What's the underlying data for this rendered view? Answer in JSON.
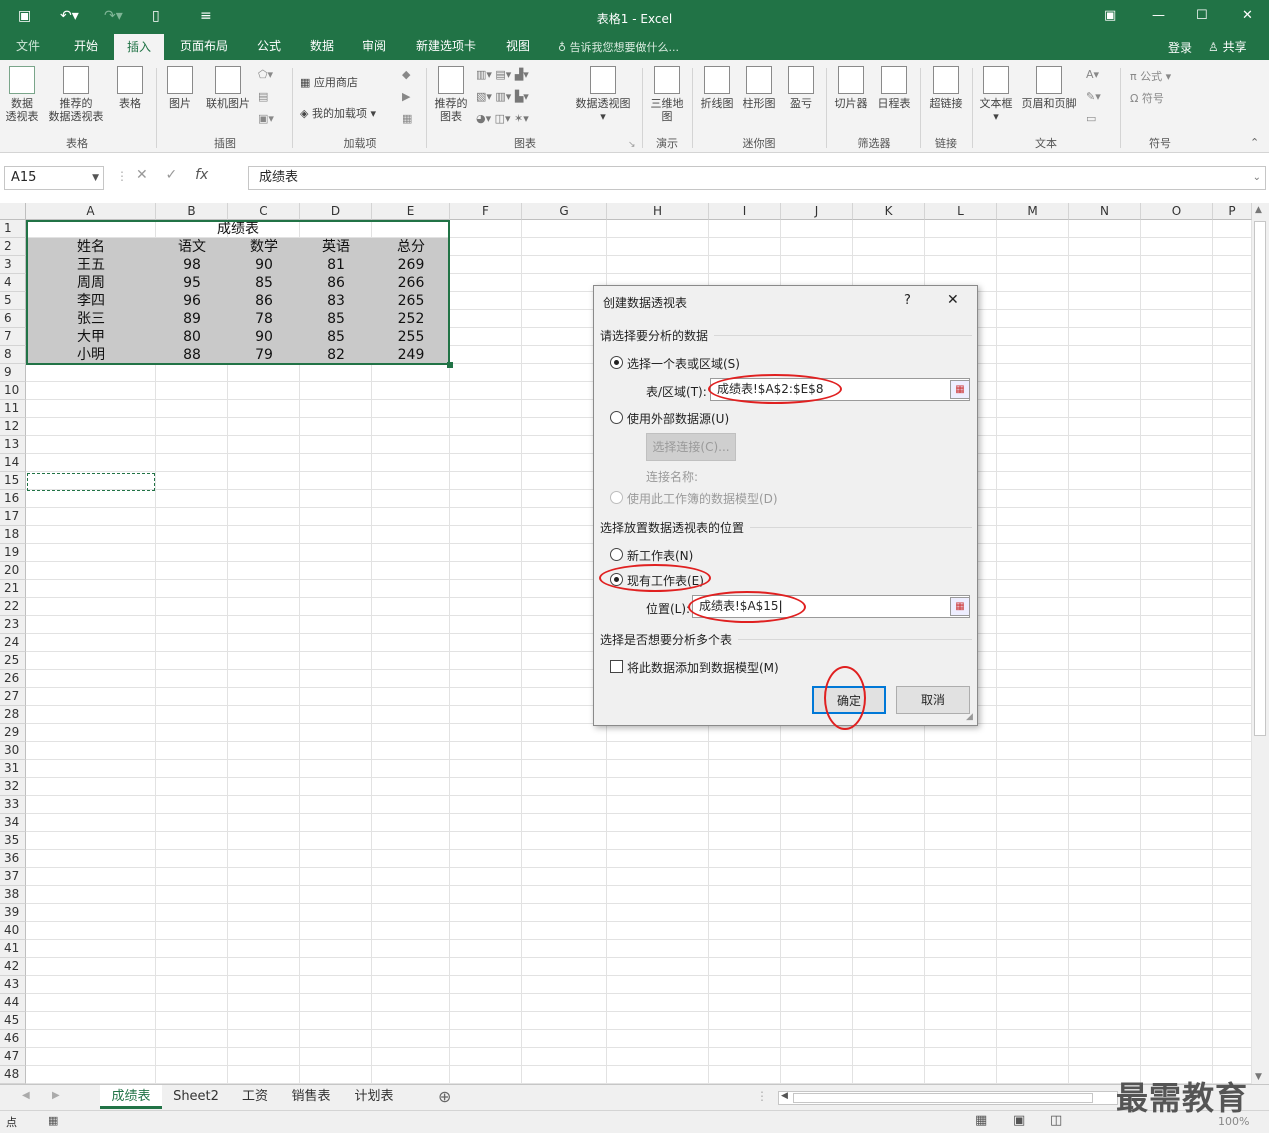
{
  "window": {
    "title": "表格1 - Excel"
  },
  "tabs": [
    "文件",
    "开始",
    "插入",
    "页面布局",
    "公式",
    "数据",
    "审阅",
    "新建选项卡",
    "视图"
  ],
  "tell_me": "告诉我您想要做什么...",
  "account": {
    "login": "登录",
    "share": "共享"
  },
  "ribbon": {
    "pivot": "数据\n透视表",
    "rec_pivot": "推荐的\n数据透视表",
    "table": "表格",
    "picture": "图片",
    "online_picture": "联机图片",
    "store": "应用商店",
    "my_addins": "我的加载项",
    "rec_charts": "推荐的\n图表",
    "pivot_chart": "数据透视图",
    "map3d": "三维地\n图",
    "line": "折线图",
    "column": "柱形图",
    "winloss": "盈亏",
    "slicer": "切片器",
    "timeline": "日程表",
    "hyperlink": "超链接",
    "textbox": "文本框",
    "header_footer": "页眉和页脚",
    "equation": "公式",
    "symbol": "符号",
    "groups": [
      "表格",
      "插图",
      "加载项",
      "图表",
      "演示",
      "迷你图",
      "筛选器",
      "链接",
      "文本",
      "符号"
    ]
  },
  "formula_bar": {
    "name_box": "A15",
    "content": "成绩表"
  },
  "columns": [
    "A",
    "B",
    "C",
    "D",
    "E",
    "F",
    "G",
    "H",
    "I",
    "J",
    "K",
    "L",
    "M",
    "N",
    "O",
    "P"
  ],
  "rows": [
    "1",
    "2",
    "3",
    "4",
    "5",
    "6",
    "7",
    "8",
    "9",
    "10",
    "11",
    "12",
    "13",
    "14",
    "15",
    "16",
    "17",
    "18",
    "19",
    "20",
    "21",
    "22",
    "23",
    "24",
    "25",
    "26",
    "27",
    "28",
    "29",
    "30",
    "31",
    "32",
    "33",
    "34",
    "35",
    "36",
    "37",
    "38",
    "39",
    "40",
    "41",
    "42",
    "43",
    "44",
    "45",
    "46",
    "47",
    "48"
  ],
  "sheet": {
    "title": "成绩表",
    "headers": [
      "姓名",
      "语文",
      "数学",
      "英语",
      "总分"
    ],
    "data": [
      [
        "王五",
        "98",
        "90",
        "81",
        "269"
      ],
      [
        "周周",
        "95",
        "85",
        "86",
        "266"
      ],
      [
        "李四",
        "96",
        "86",
        "83",
        "265"
      ],
      [
        "张三",
        "89",
        "78",
        "85",
        "252"
      ],
      [
        "大甲",
        "80",
        "90",
        "85",
        "255"
      ],
      [
        "小明",
        "88",
        "79",
        "82",
        "249"
      ]
    ]
  },
  "sheet_tabs": [
    "成绩表",
    "Sheet2",
    "工资",
    "销售表",
    "计划表"
  ],
  "status": {
    "zoom": "100%"
  },
  "watermark": "最需教育",
  "dialog": {
    "title": "创建数据透视表",
    "help": "?",
    "close": "✕",
    "section1": "请选择要分析的数据",
    "opt_range": "选择一个表或区域(S)",
    "range_label": "表/区域(T):",
    "range_value": "成绩表!$A$2:$E$8",
    "opt_external": "使用外部数据源(U)",
    "choose_conn": "选择连接(C)...",
    "conn_name": "连接名称:",
    "opt_model": "使用此工作簿的数据模型(D)",
    "section2": "选择放置数据透视表的位置",
    "opt_new": "新工作表(N)",
    "opt_existing": "现有工作表(E)",
    "loc_label": "位置(L):",
    "loc_value": "成绩表!$A$15",
    "section3": "选择是否想要分析多个表",
    "add_model": "将此数据添加到数据模型(M)",
    "ok": "确定",
    "cancel": "取消"
  }
}
